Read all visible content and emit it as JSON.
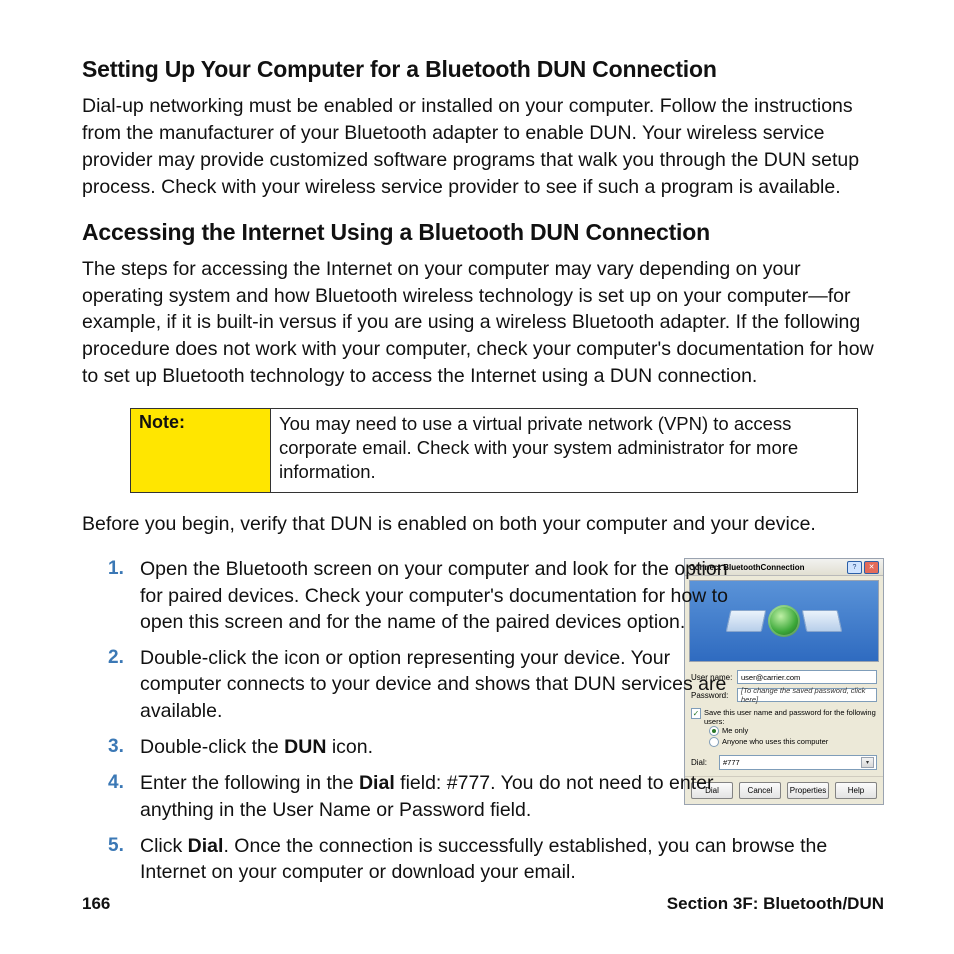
{
  "heading1": "Setting Up Your Computer for a Bluetooth DUN Connection",
  "para1": "Dial-up networking must be enabled or installed on your computer. Follow the instructions from the manufacturer of your Bluetooth adapter to enable DUN. Your wireless service provider may provide customized software programs that walk you through the DUN setup process. Check with your wireless service provider to see if such a program is available.",
  "heading2": "Accessing the Internet Using a Bluetooth DUN Connection",
  "para2": "The steps for accessing the Internet on your computer may vary depending on your operating system and how Bluetooth wireless technology is set up on your computer—for example, if it is built-in versus if you are using a wireless Bluetooth adapter. If the following procedure does not work with your computer, check your computer's documentation for how to set up Bluetooth technology to access the Internet using a DUN connection.",
  "note_label": "Note:",
  "note_text": "You may need to use a virtual private network (VPN) to access corporate email. Check with your system administrator for more information.",
  "para3": "Before you begin, verify that DUN is enabled on both your computer and your device.",
  "steps": {
    "s1": "Open the Bluetooth screen on your computer and look for the option for paired devices. Check your computer's documentation for how to open this screen and for the name of the paired devices option.",
    "s2": "Double-click the icon or option representing your device. Your computer connects to your device and shows that DUN services are available.",
    "s3_pre": "Double-click the ",
    "s3_b": "DUN",
    "s3_post": " icon.",
    "s4_pre": "Enter the following in the ",
    "s4_b": "Dial",
    "s4_post": " field: #777. You do not need to enter anything in the User Name or Password field.",
    "s5_pre": "Click ",
    "s5_b": "Dial",
    "s5_post": ". Once the connection is successfully established, you can browse the Internet on your computer or download your email."
  },
  "dialog": {
    "title": "Connect BluetoothConnection",
    "username_label": "User name:",
    "username_value": "user@carrier.com",
    "password_label": "Password:",
    "password_value": "[To change the saved password, click here]",
    "save_checkbox": "Save this user name and password for the following users:",
    "radio_me": "Me only",
    "radio_anyone": "Anyone who uses this computer",
    "dial_label": "Dial:",
    "dial_value": "#777",
    "btn_dial": "Dial",
    "btn_cancel": "Cancel",
    "btn_props": "Properties",
    "btn_help": "Help"
  },
  "footer_left": "166",
  "footer_right": "Section 3F: Bluetooth/DUN"
}
